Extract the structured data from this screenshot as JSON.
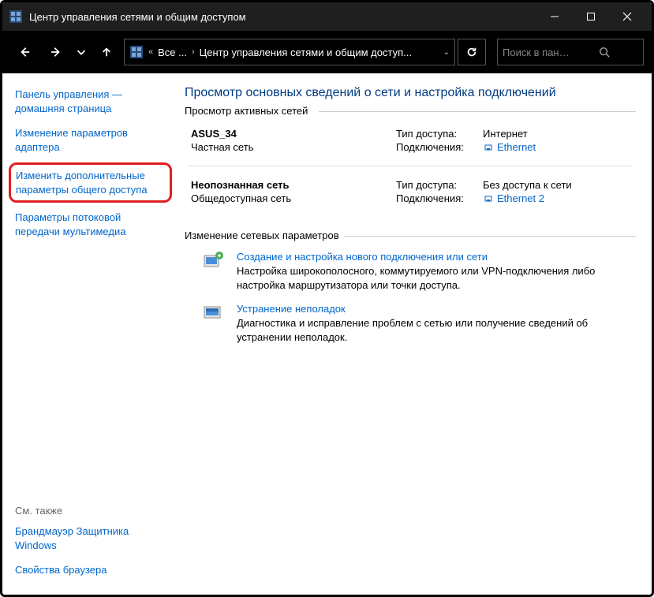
{
  "window": {
    "title": "Центр управления сетями и общим доступом"
  },
  "breadcrumb": {
    "root": "Все ...",
    "current": "Центр управления сетями и общим доступ..."
  },
  "search": {
    "placeholder": "Поиск в панели упра..."
  },
  "sidebar": {
    "home": "Панель управления — домашняя страница",
    "adapter": "Изменение параметров адаптера",
    "advanced": "Изменить дополнительные параметры общего доступа",
    "streaming": "Параметры потоковой передачи мультимедиа",
    "see_also": "См. также",
    "firewall": "Брандмауэр Защитника Windows",
    "browser": "Свойства браузера"
  },
  "main": {
    "heading": "Просмотр основных сведений о сети и настройка подключений",
    "active_networks_label": "Просмотр активных сетей",
    "networks": [
      {
        "name": "ASUS_34",
        "type": "Частная сеть",
        "access_label": "Тип доступа:",
        "access_value": "Интернет",
        "conn_label": "Подключения:",
        "conn_value": "Ethernet"
      },
      {
        "name": "Неопознанная сеть",
        "type": "Общедоступная сеть",
        "access_label": "Тип доступа:",
        "access_value": "Без доступа к сети",
        "conn_label": "Подключения:",
        "conn_value": "Ethernet 2"
      }
    ],
    "change_settings_label": "Изменение сетевых параметров",
    "task_new_title": "Создание и настройка нового подключения или сети",
    "task_new_desc": "Настройка широкополосного, коммутируемого или VPN-подключения либо настройка маршрутизатора или точки доступа.",
    "task_trouble_title": "Устранение неполадок",
    "task_trouble_desc": "Диагностика и исправление проблем с сетью или получение сведений об устранении неполадок."
  }
}
